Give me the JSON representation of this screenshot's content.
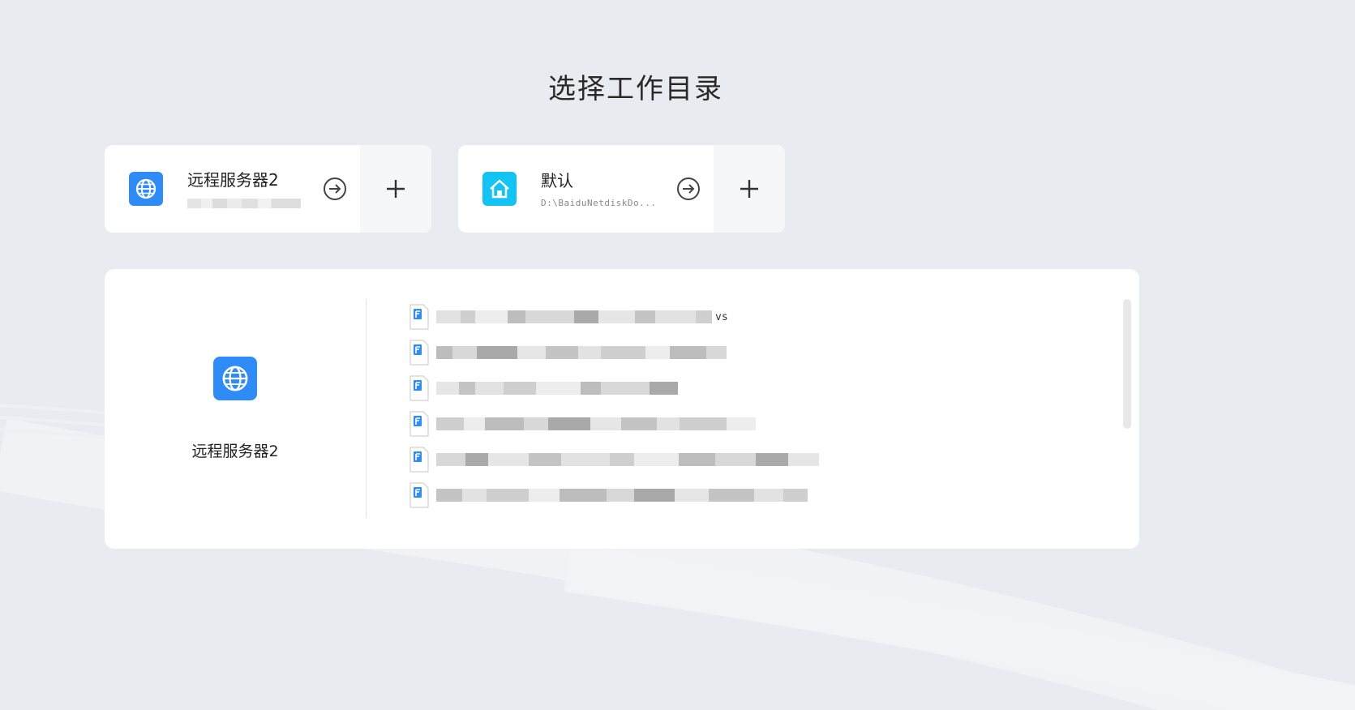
{
  "page": {
    "title": "选择工作目录"
  },
  "workspaces": [
    {
      "name": "远程服务器2",
      "path": "",
      "icon": "globe-icon",
      "color": "#2f8cf6"
    },
    {
      "name": "默认",
      "path": "D:\\BaiduNetdiskDo...",
      "icon": "home-icon",
      "color": "#12c3f4"
    }
  ],
  "panel": {
    "server_label": "远程服务器2",
    "files": [
      {
        "suffix": "vs",
        "icon": "file-icon"
      },
      {
        "suffix": "",
        "icon": "file-icon"
      },
      {
        "suffix": "",
        "icon": "file-icon"
      },
      {
        "suffix": "",
        "icon": "file-icon"
      },
      {
        "suffix": "",
        "icon": "file-icon"
      },
      {
        "suffix": "",
        "icon": "file-icon"
      }
    ]
  }
}
